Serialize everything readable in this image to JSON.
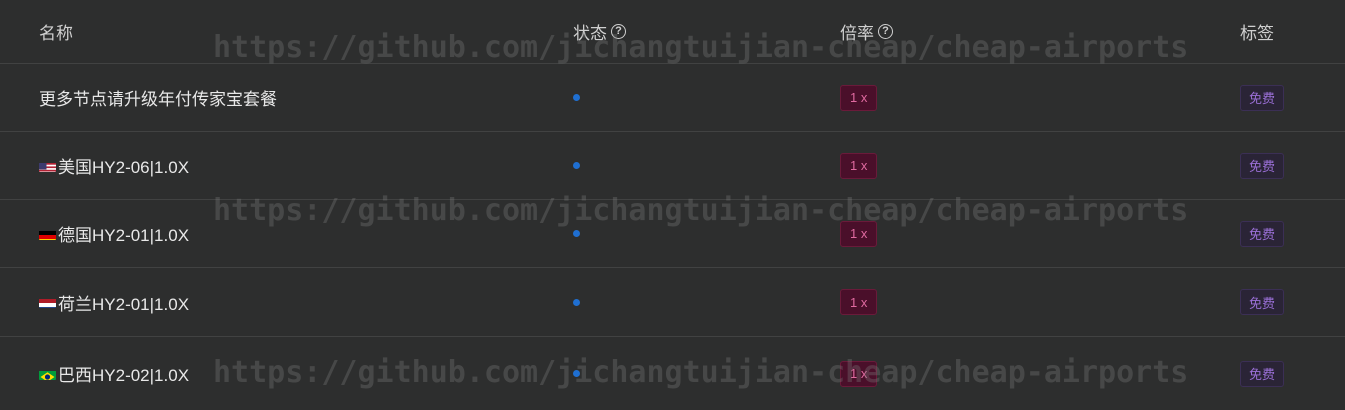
{
  "table": {
    "headers": {
      "name": "名称",
      "status": "状态",
      "rate": "倍率",
      "tag": "标签"
    },
    "rows": [
      {
        "name": "更多节点请升级年付传家宝套餐",
        "flag": "",
        "rate": "1 x",
        "tag": "免费"
      },
      {
        "name": "美国HY2-06|1.0X",
        "flag": "us-flag-icon",
        "rate": "1 x",
        "tag": "免费"
      },
      {
        "name": "德国HY2-01|1.0X",
        "flag": "de-flag-icon",
        "rate": "1 x",
        "tag": "免费"
      },
      {
        "name": "荷兰HY2-01|1.0X",
        "flag": "nl-flag-icon",
        "rate": "1 x",
        "tag": "免费"
      },
      {
        "name": "巴西HY2-02|1.0X",
        "flag": "br-flag-icon",
        "rate": "1 x",
        "tag": "免费"
      }
    ]
  },
  "watermark": "https://github.com/jichangtuijian-cheap/cheap-airports",
  "colors": {
    "background": "#2d2e2e",
    "status_dot": "#1f6fd1",
    "rate_text": "#e06aa0",
    "tag_text": "#9a6fd6"
  }
}
